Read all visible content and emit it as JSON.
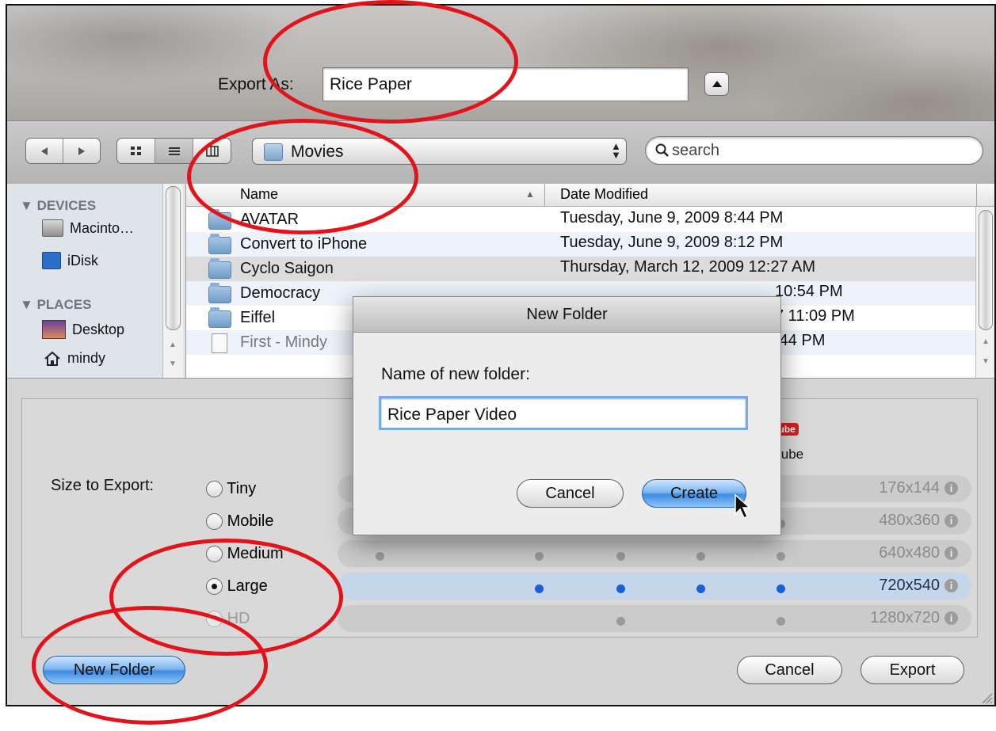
{
  "export": {
    "label": "Export As:",
    "value": "Rice Paper"
  },
  "toolbar": {
    "location": "Movies",
    "search_placeholder": "search"
  },
  "sidebar": {
    "devices_header": "DEVICES",
    "devices": [
      {
        "label": "Macinto…",
        "icon": "hard-drive-icon"
      },
      {
        "label": "iDisk",
        "icon": "idisk-icon"
      }
    ],
    "places_header": "PLACES",
    "places": [
      {
        "label": "Desktop",
        "icon": "desktop-icon"
      },
      {
        "label": "mindy",
        "icon": "home-icon"
      }
    ]
  },
  "columns": {
    "name": "Name",
    "date": "Date Modified"
  },
  "files": [
    {
      "name": "AVATAR",
      "date": "Tuesday, June 9, 2009 8:44 PM"
    },
    {
      "name": "Convert to iPhone",
      "date": "Tuesday, June 9, 2009 8:12 PM"
    },
    {
      "name": "Cyclo Saigon",
      "date": "Thursday, March 12, 2009 12:27 AM"
    },
    {
      "name": "Democracy",
      "date": "10:54 PM"
    },
    {
      "name": "Eiffel",
      "date": "7 11:09 PM"
    },
    {
      "name": "First - Mindy",
      "date": ":44 PM"
    }
  ],
  "size": {
    "label": "Size to Export:",
    "youtube_label": "Tube",
    "youtube_logo": "Tube",
    "options": [
      {
        "label": "Tiny",
        "res": "176x144"
      },
      {
        "label": "Mobile",
        "res": "480x360"
      },
      {
        "label": "Medium",
        "res": "640x480"
      },
      {
        "label": "Large",
        "res": "720x540"
      },
      {
        "label": "HD",
        "res": "1280x720"
      }
    ],
    "selected": "Large"
  },
  "buttons": {
    "new_folder": "New Folder",
    "cancel": "Cancel",
    "export": "Export"
  },
  "new_folder_sheet": {
    "title": "New Folder",
    "prompt": "Name of new folder:",
    "value": "Rice Paper Video",
    "cancel": "Cancel",
    "create": "Create"
  },
  "colors": {
    "annotation": "#e2131a",
    "selection_blue": "#1a5fd6",
    "default_button": "#3f8ce0"
  }
}
